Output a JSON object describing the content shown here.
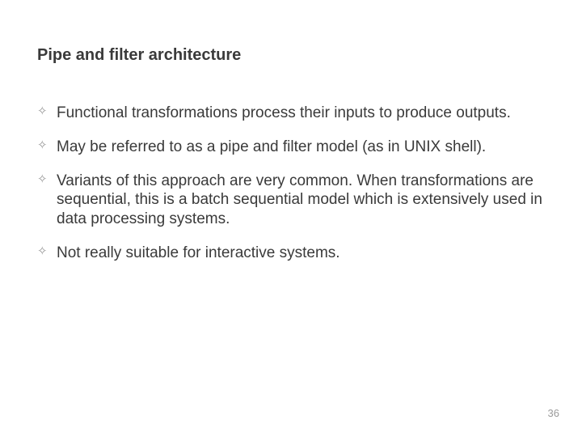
{
  "slide": {
    "title": "Pipe and filter architecture",
    "bullets": [
      "Functional transformations process their inputs to produce outputs.",
      "May be referred to as a pipe and filter model (as in UNIX shell).",
      "Variants of this approach are very common. When transformations are sequential, this is a batch sequential model which is extensively used in data processing systems.",
      "Not really suitable for interactive systems."
    ],
    "bullet_marker": "✧",
    "page_number": "36"
  }
}
